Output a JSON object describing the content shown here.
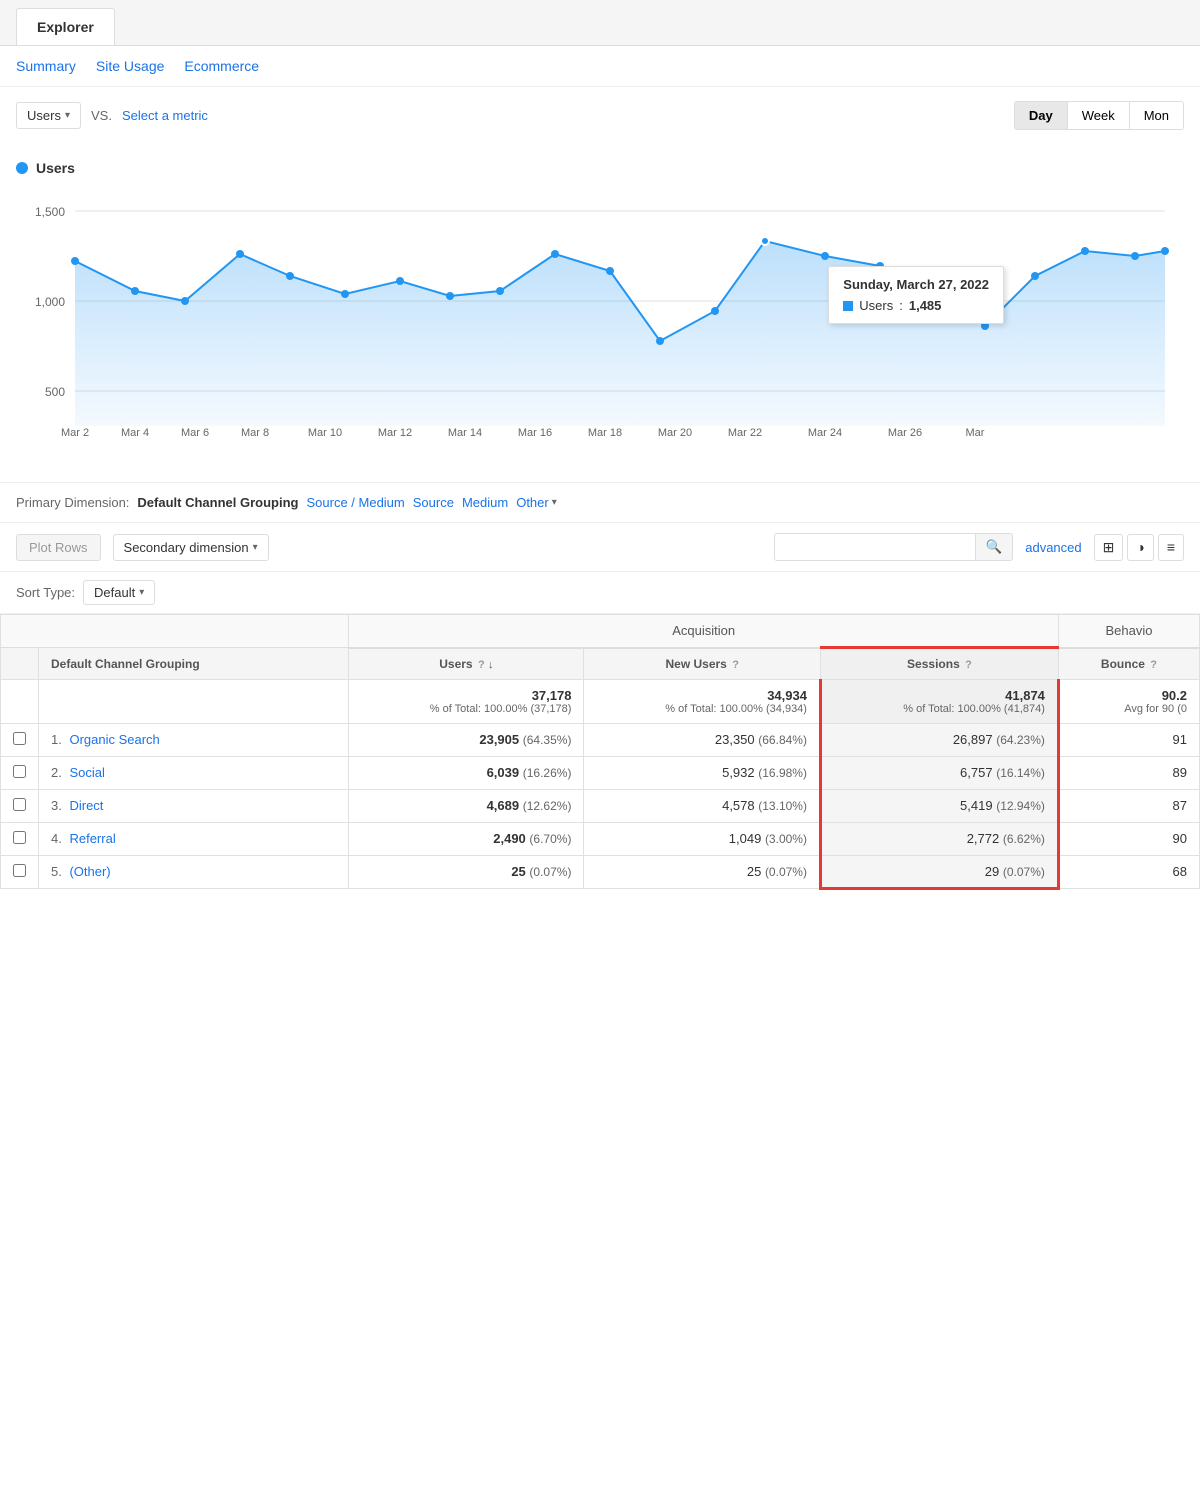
{
  "tab": {
    "label": "Explorer"
  },
  "sub_tabs": [
    {
      "label": "Summary",
      "active": false
    },
    {
      "label": "Site Usage",
      "active": false
    },
    {
      "label": "Ecommerce",
      "active": false
    }
  ],
  "metric_selector": {
    "metric": "Users",
    "vs_label": "VS.",
    "select_metric_label": "Select a metric"
  },
  "time_buttons": [
    {
      "label": "Day",
      "active": true
    },
    {
      "label": "Week",
      "active": false
    },
    {
      "label": "Mon",
      "active": false
    }
  ],
  "chart": {
    "metric_label": "Users",
    "y_labels": [
      "1,500",
      "1,000",
      "500"
    ],
    "x_labels": [
      "Mar 2",
      "Mar 4",
      "Mar 6",
      "Mar 8",
      "Mar 10",
      "Mar 12",
      "Mar 14",
      "Mar 16",
      "Mar 18",
      "Mar 20",
      "Mar 22",
      "Mar 24",
      "Mar 26",
      "Mar"
    ],
    "tooltip": {
      "date": "Sunday, March 27, 2022",
      "metric": "Users",
      "value": "1,485"
    }
  },
  "primary_dimension": {
    "label": "Primary Dimension:",
    "active": "Default Channel Grouping",
    "links": [
      "Source / Medium",
      "Source",
      "Medium"
    ],
    "other_label": "Other"
  },
  "controls": {
    "plot_rows_label": "Plot Rows",
    "secondary_dim_label": "Secondary dimension",
    "search_placeholder": "",
    "advanced_label": "advanced",
    "sort_label": "Sort Type:",
    "sort_value": "Default"
  },
  "table": {
    "acquisition_header": "Acquisition",
    "behavior_header": "Behavio",
    "col_headers": [
      {
        "label": "Default Channel Grouping",
        "colspan": 1,
        "type": "dimension"
      },
      {
        "label": "Users",
        "help": true,
        "sorted": true
      },
      {
        "label": "New Users",
        "help": true
      },
      {
        "label": "Sessions",
        "help": true,
        "sessions": true
      },
      {
        "label": "Bounce",
        "help": true,
        "partial": true
      }
    ],
    "totals": {
      "users": "37,178",
      "users_sub": "% of Total: 100.00% (37,178)",
      "new_users": "34,934",
      "new_users_sub": "% of Total: 100.00% (34,934)",
      "sessions": "41,874",
      "sessions_sub": "% of Total: 100.00% (41,874)",
      "bounce": "90.2",
      "bounce_sub": "Avg for 90 (0"
    },
    "rows": [
      {
        "num": "1.",
        "channel": "Organic Search",
        "users": "23,905",
        "users_pct": "(64.35%)",
        "new_users": "23,350",
        "new_users_pct": "(66.84%)",
        "sessions": "26,897",
        "sessions_pct": "(64.23%)",
        "bounce": "91"
      },
      {
        "num": "2.",
        "channel": "Social",
        "users": "6,039",
        "users_pct": "(16.26%)",
        "new_users": "5,932",
        "new_users_pct": "(16.98%)",
        "sessions": "6,757",
        "sessions_pct": "(16.14%)",
        "bounce": "89"
      },
      {
        "num": "3.",
        "channel": "Direct",
        "users": "4,689",
        "users_pct": "(12.62%)",
        "new_users": "4,578",
        "new_users_pct": "(13.10%)",
        "sessions": "5,419",
        "sessions_pct": "(12.94%)",
        "bounce": "87"
      },
      {
        "num": "4.",
        "channel": "Referral",
        "users": "2,490",
        "users_pct": "(6.70%)",
        "new_users": "1,049",
        "new_users_pct": "(3.00%)",
        "sessions": "2,772",
        "sessions_pct": "(6.62%)",
        "bounce": "90"
      },
      {
        "num": "5.",
        "channel": "(Other)",
        "users": "25",
        "users_pct": "(0.07%)",
        "new_users": "25",
        "new_users_pct": "(0.07%)",
        "sessions": "29",
        "sessions_pct": "(0.07%)",
        "bounce": "68"
      }
    ]
  }
}
